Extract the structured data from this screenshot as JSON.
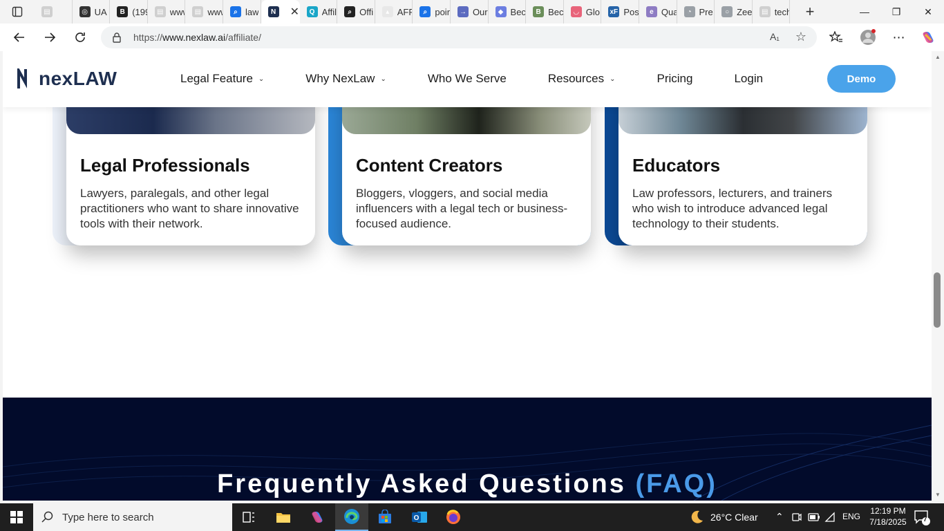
{
  "browser": {
    "tabs": [
      {
        "label": "",
        "icon": "page-icon"
      },
      {
        "label": "UA I",
        "icon": "openai-icon"
      },
      {
        "label": "(199",
        "icon": "b-icon"
      },
      {
        "label": "www",
        "icon": "page-icon"
      },
      {
        "label": "www",
        "icon": "page-icon"
      },
      {
        "label": "law",
        "icon": "search-icon"
      },
      {
        "label": "",
        "icon": "nexlaw-icon",
        "active": true
      },
      {
        "label": "Affil",
        "icon": "q-icon"
      },
      {
        "label": "Offi",
        "icon": "magnifier-icon"
      },
      {
        "label": "AFF",
        "icon": "aff-icon"
      },
      {
        "label": "poin",
        "icon": "search-icon"
      },
      {
        "label": "Our",
        "icon": "our-icon"
      },
      {
        "label": "Bec",
        "icon": "shield-icon"
      },
      {
        "label": "Bec",
        "icon": "bec-icon"
      },
      {
        "label": "Glo",
        "icon": "glo-icon"
      },
      {
        "label": "Post",
        "icon": "xf-icon"
      },
      {
        "label": "Qua",
        "icon": "qua-icon"
      },
      {
        "label": "Pre",
        "icon": "pre-icon"
      },
      {
        "label": "Zee",
        "icon": "globe-icon"
      },
      {
        "label": "tech",
        "icon": "page-icon"
      }
    ],
    "url_prefix": "https://",
    "url_host": "www.nexlaw.ai",
    "url_path": "/affiliate/"
  },
  "site": {
    "logo_text": "nexLAW",
    "nav": [
      {
        "label": "Legal Feature",
        "dropdown": true
      },
      {
        "label": "Why NexLaw",
        "dropdown": true
      },
      {
        "label": "Who We Serve",
        "dropdown": false
      },
      {
        "label": "Resources",
        "dropdown": true
      },
      {
        "label": "Pricing",
        "dropdown": false
      },
      {
        "label": "Login",
        "dropdown": false
      }
    ],
    "demo_label": "Demo"
  },
  "cards": [
    {
      "title": "Legal Professionals",
      "description": "Lawyers, paralegals, and other legal practitioners who want to share innovative tools with their network.",
      "accent": "#eef3fb"
    },
    {
      "title": "Content Creators",
      "description": "Bloggers, vloggers, and social media influencers with a legal tech or business-focused audience.",
      "accent": "#2b86d8"
    },
    {
      "title": "Educators",
      "description": "Law professors, lecturers, and trainers who wish to introduce advanced legal technology to their students.",
      "accent": "#0c4a96"
    }
  ],
  "faq": {
    "heading_main": "Frequently Asked Questions",
    "heading_accent": "(FAQ)"
  },
  "taskbar": {
    "search_placeholder": "Type here to search",
    "weather": "26°C  Clear",
    "lang": "ENG",
    "time": "12:19 PM",
    "date": "7/18/2025",
    "notifications": "7"
  },
  "colors": {
    "brand_navy": "#1e2f50",
    "demo_blue": "#4aa3ea",
    "faq_bg": "#020b2b",
    "faq_accent": "#4a9ae8"
  }
}
